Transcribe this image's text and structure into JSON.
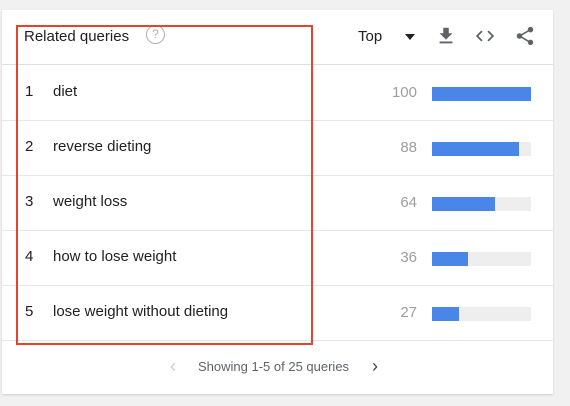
{
  "widget": {
    "title": "Related queries",
    "help_glyph": "?",
    "selector_label": "Top",
    "icons": [
      "help-icon",
      "download-icon",
      "embed-code-icon",
      "share-icon"
    ]
  },
  "rows": [
    {
      "rank": "1",
      "query": "diet",
      "value": "100",
      "level": 100
    },
    {
      "rank": "2",
      "query": "reverse dieting",
      "value": "88",
      "level": 88
    },
    {
      "rank": "3",
      "query": "weight loss",
      "value": "64",
      "level": 64
    },
    {
      "rank": "4",
      "query": "how to lose weight",
      "value": "36",
      "level": 36
    },
    {
      "rank": "5",
      "query": "lose weight without dieting",
      "value": "27",
      "level": 27
    }
  ],
  "pagination": {
    "text": "Showing 1-5 of 25 queries",
    "prev_glyph": "‹",
    "next_glyph": "›"
  },
  "colors": {
    "bar": "#4a86e8",
    "bar_track": "#eeeeee",
    "highlight": "#e5432e"
  }
}
